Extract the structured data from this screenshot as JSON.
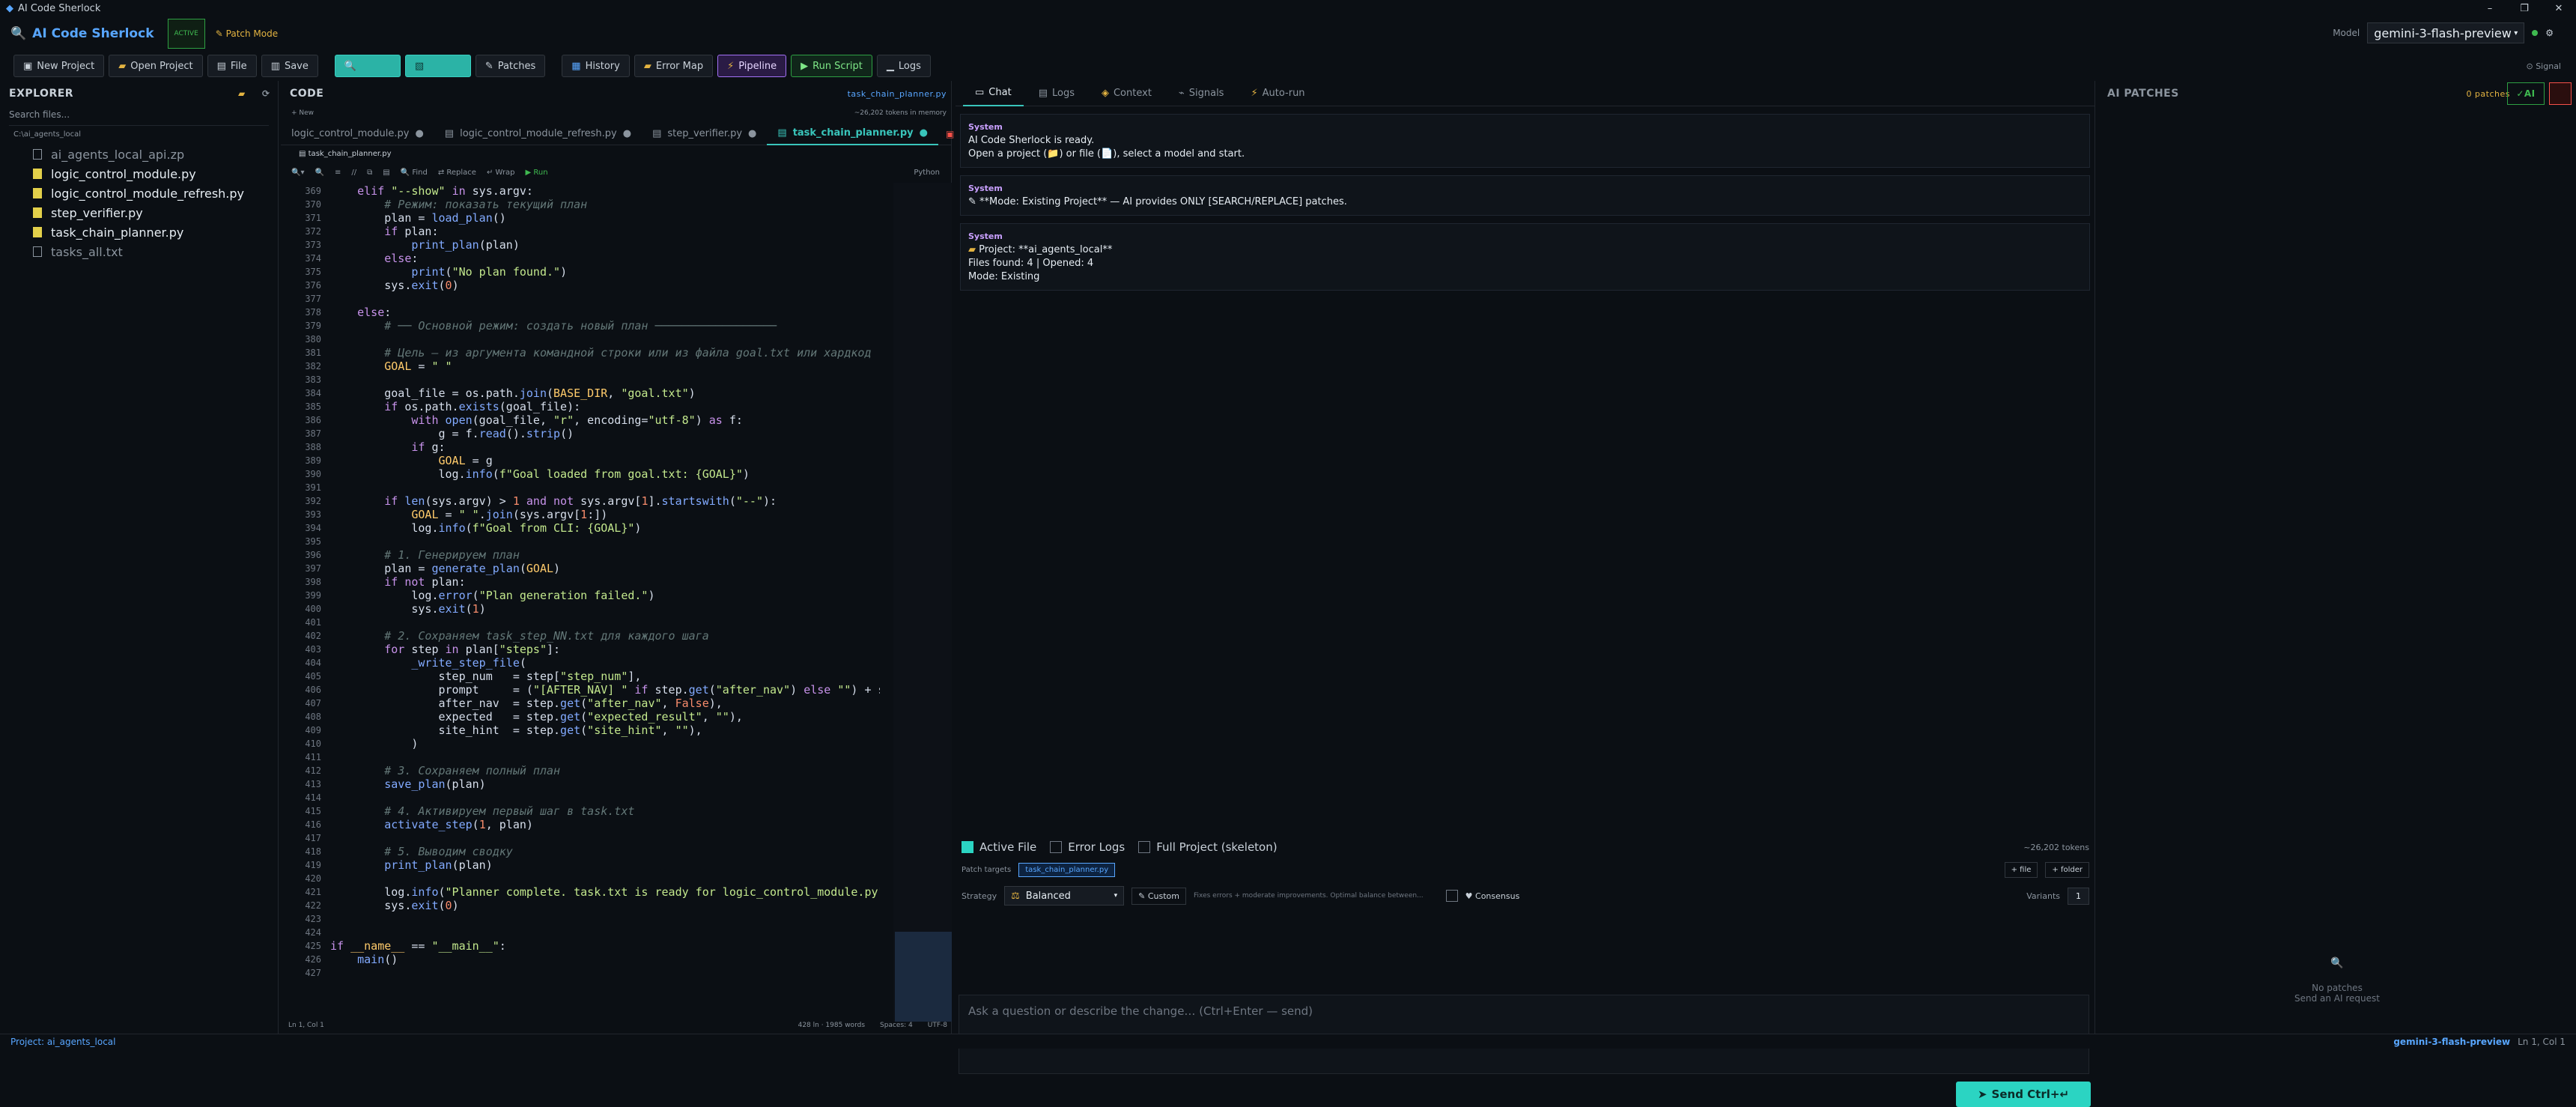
{
  "window": {
    "title": "AI Code Sherlock",
    "controls": [
      "–",
      "❐",
      "✕"
    ]
  },
  "header": {
    "logo": "AI Code Sherlock",
    "status_badge": "ACTIVE",
    "mode": "Patch Mode",
    "model_label": "Model",
    "model_value": "gemini-3-flash-preview"
  },
  "toolbar": {
    "buttons": [
      "New Project",
      "Open Project",
      "File",
      "Save",
      "",
      "",
      "Patches",
      "History",
      "Error Map",
      "Pipeline",
      "Run Script",
      "Logs"
    ],
    "signal": "Signal"
  },
  "explorer": {
    "title": "EXPLORER",
    "search_placeholder": "Search files...",
    "path": "C:\\ai_agents_local",
    "files": [
      "ai_agents_local_api.zp",
      "logic_control_module.py",
      "logic_control_module_refresh.py",
      "step_verifier.py",
      "task_chain_planner.py",
      "tasks_all.txt"
    ]
  },
  "code": {
    "title": "CODE",
    "open_file": "task_chain_planner.py",
    "tokens": "~26,202 tokens in memory",
    "new_label": "+ New",
    "tabs": [
      "logic_control_module.py",
      "logic_control_module_refresh.py",
      "step_verifier.py",
      "task_chain_planner.py"
    ],
    "breadcrumb": "task_chain_planner.py",
    "editor_tools": [
      "Find",
      "Replace",
      "Wrap",
      "Run"
    ],
    "lang": "Python",
    "status_left": "Ln 1, Col 1",
    "status_mid": "428 ln · 1985 words",
    "status_spaces": "Spaces: 4",
    "status_enc": "UTF-8"
  },
  "chat": {
    "tabs": [
      "Chat",
      "Logs",
      "Context",
      "Signals",
      "Auto-run"
    ],
    "messages": [
      {
        "from": "System",
        "lines": [
          "AI Code Sherlock is ready.",
          "Open a project (📁) or file (📄), select a model and start."
        ]
      },
      {
        "from": "System",
        "lines": [
          "**Mode: Existing Project** — AI provides ONLY [SEARCH/REPLACE] patches."
        ]
      },
      {
        "from": "System",
        "lines": [
          "Project: **ai_agents_local**",
          "Files found: 4 | Opened: 4",
          "Mode: Existing"
        ]
      }
    ],
    "context_checks": [
      "Active File",
      "Error Logs",
      "Full Project (skeleton)"
    ],
    "tokens": "~26,202 tokens",
    "patch_targets_label": "Patch targets",
    "patch_target": "task_chain_planner.py",
    "file_btn": "+ file",
    "folder_btn": "+ folder",
    "strategy_label": "Strategy",
    "strategy": "Balanced",
    "custom": "Custom",
    "custom_hint": "Fixes errors + moderate improvements. Optimal balance between...",
    "consensus": "Consensus",
    "variants_label": "Variants",
    "variants": "1",
    "input_placeholder": "Ask a question or describe the change… (Ctrl+Enter — send)",
    "send": "Send  Ctrl+↵"
  },
  "patches": {
    "title": "AI PATCHES",
    "count": "0 patches",
    "empty_title": "No patches",
    "empty_sub": "Send an AI request",
    "ai_btn": "AI"
  },
  "status": {
    "project": "Project: ai_agents_local",
    "model": "gemini-3-flash-preview",
    "pos": "Ln 1, Col 1"
  }
}
